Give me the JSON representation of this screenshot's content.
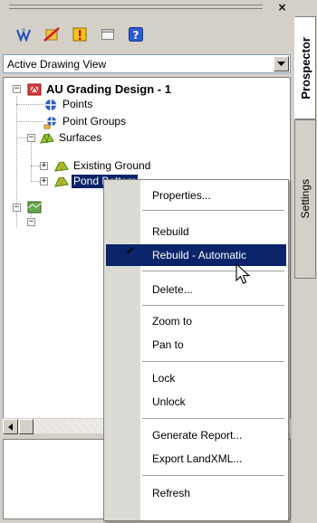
{
  "palette": {
    "close_glyph": "×",
    "toolbar": [
      {
        "name": "prospector-view-icon",
        "color": "#1f4fb5"
      },
      {
        "name": "no-items-icon",
        "color": "#d02020"
      },
      {
        "name": "warning-shield-icon",
        "color": "#d0a010"
      },
      {
        "name": "window-icon",
        "color": "#808080"
      },
      {
        "name": "help-icon",
        "color": "#1f4fb5",
        "glyph": "?"
      }
    ],
    "view_select": {
      "value": "Active Drawing View"
    },
    "tree": {
      "root": {
        "label": "AU Grading Design - 1",
        "expander": "−"
      },
      "points": {
        "label": "Points"
      },
      "point_groups": {
        "label": "Point Groups"
      },
      "surfaces": {
        "label": "Surfaces",
        "expander": "−"
      },
      "existing_ground": {
        "label": "Existing Ground",
        "expander": "+"
      },
      "pond_bottom": {
        "label": "Pond Bottom",
        "expander": "+"
      },
      "site_expander": "−",
      "site_child_expander": "−"
    },
    "side_tabs": {
      "prospector": "Prospector",
      "settings": "Settings"
    }
  },
  "context_menu": {
    "items": [
      {
        "label": "Properties..."
      },
      {
        "label": "Rebuild"
      },
      {
        "label": "Rebuild - Automatic",
        "checked": true,
        "highlighted": true,
        "check_glyph": "✔"
      },
      {
        "label": "Delete..."
      },
      {
        "label": "Zoom to"
      },
      {
        "label": "Pan to"
      },
      {
        "label": "Lock"
      },
      {
        "label": "Unlock"
      },
      {
        "label": "Generate Report..."
      },
      {
        "label": "Export LandXML..."
      },
      {
        "label": "Refresh"
      }
    ]
  },
  "colors": {
    "selection": "#0a246a",
    "accent": "#1f4fb5"
  }
}
